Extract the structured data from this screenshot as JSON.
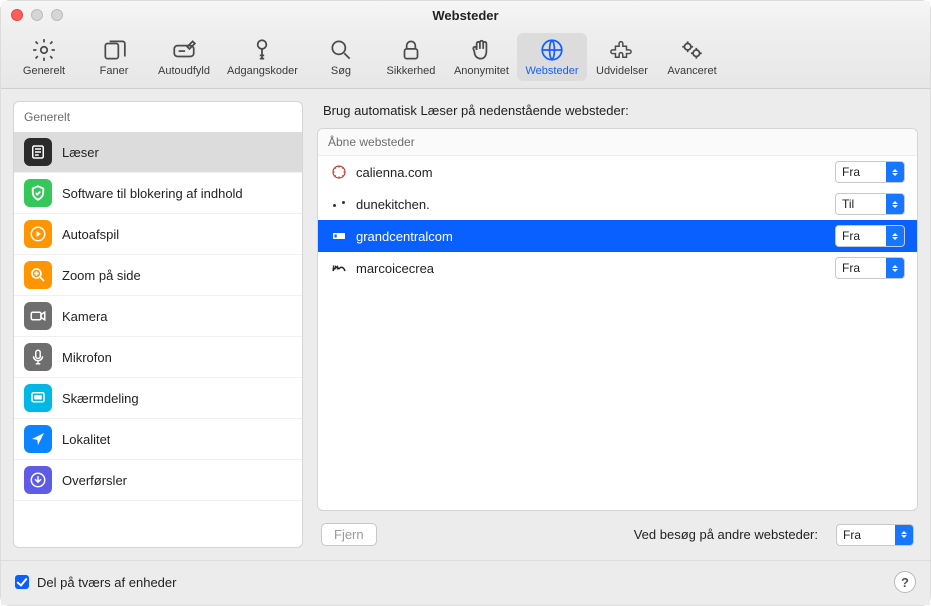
{
  "window": {
    "title": "Websteder"
  },
  "toolbar": {
    "items": [
      {
        "label": "Generelt"
      },
      {
        "label": "Faner"
      },
      {
        "label": "Autoudfyld"
      },
      {
        "label": "Adgangskoder"
      },
      {
        "label": "Søg"
      },
      {
        "label": "Sikkerhed"
      },
      {
        "label": "Anonymitet"
      },
      {
        "label": "Websteder"
      },
      {
        "label": "Udvidelser"
      },
      {
        "label": "Avanceret"
      }
    ],
    "selected_index": 7
  },
  "sidebar": {
    "section": "Generelt",
    "items": [
      {
        "label": "Læser",
        "color": "#2b2b2b"
      },
      {
        "label": "Software til blokering af indhold",
        "color": "#34c759"
      },
      {
        "label": "Autoafspil",
        "color": "#ff9500"
      },
      {
        "label": "Zoom på side",
        "color": "#ff9500"
      },
      {
        "label": "Kamera",
        "color": "#6e6e6e"
      },
      {
        "label": "Mikrofon",
        "color": "#6e6e6e"
      },
      {
        "label": "Skærmdeling",
        "color": "#00b7e6"
      },
      {
        "label": "Lokalitet",
        "color": "#0a84ff"
      },
      {
        "label": "Overførsler",
        "color": "#5e5ce6"
      }
    ],
    "selected_index": 0
  },
  "main": {
    "heading": "Brug automatisk Læser på nedenstående websteder:",
    "column_header": "Åbne websteder",
    "rows": [
      {
        "site": "calienna.com",
        "value": "Fra"
      },
      {
        "site": "dunekitchen.",
        "value": "Til"
      },
      {
        "site": "grandcentralcom",
        "value": "Fra"
      },
      {
        "site": "marcoicecrea",
        "value": "Fra"
      }
    ],
    "selected_index": 2,
    "options": [
      "Til",
      "Fra"
    ],
    "remove_label": "Fjern",
    "other_sites_label": "Ved besøg på andre websteder:",
    "other_sites_value": "Fra"
  },
  "footer": {
    "share_label": "Del på tværs af enheder",
    "share_checked": true,
    "help_label": "?"
  }
}
